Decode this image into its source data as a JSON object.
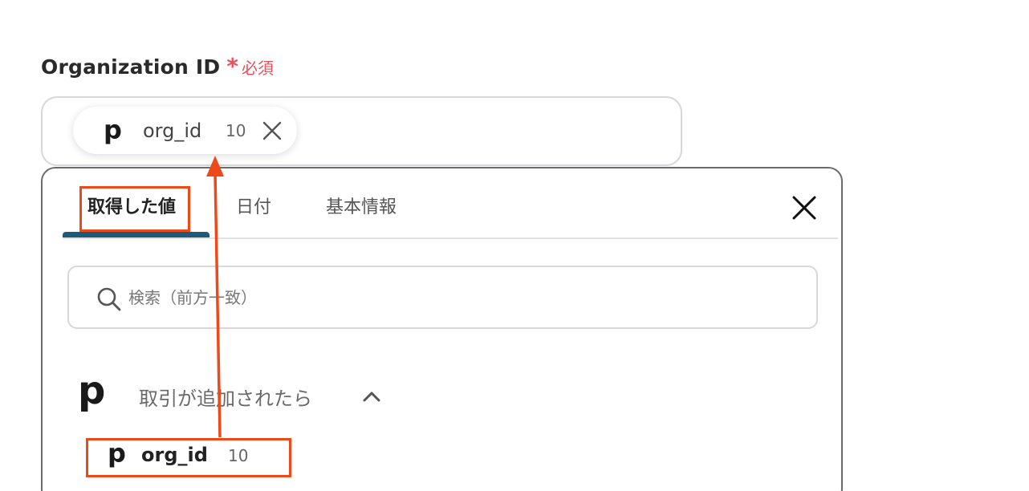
{
  "field": {
    "label": "Organization ID",
    "required_mark": "*",
    "required_text": "必須"
  },
  "chip": {
    "logo": "p",
    "value": "org_id",
    "count": "10",
    "close_icon": "close-icon"
  },
  "panel": {
    "tabs": [
      {
        "label": "取得した値",
        "active": true
      },
      {
        "label": "日付",
        "active": false
      },
      {
        "label": "基本情報",
        "active": false
      }
    ],
    "close_icon": "close-icon",
    "search": {
      "placeholder": "検索（前方一致）",
      "icon": "search-icon"
    },
    "group": {
      "logo": "p",
      "title": "取引が追加されたら",
      "toggle_icon": "chevron-up-icon",
      "expanded": true,
      "items": [
        {
          "logo": "p",
          "value": "org_id",
          "count": "10"
        }
      ]
    }
  },
  "colors": {
    "accent": "#1d5b79",
    "required": "#e8505b",
    "annotation": "#ee4a19"
  }
}
